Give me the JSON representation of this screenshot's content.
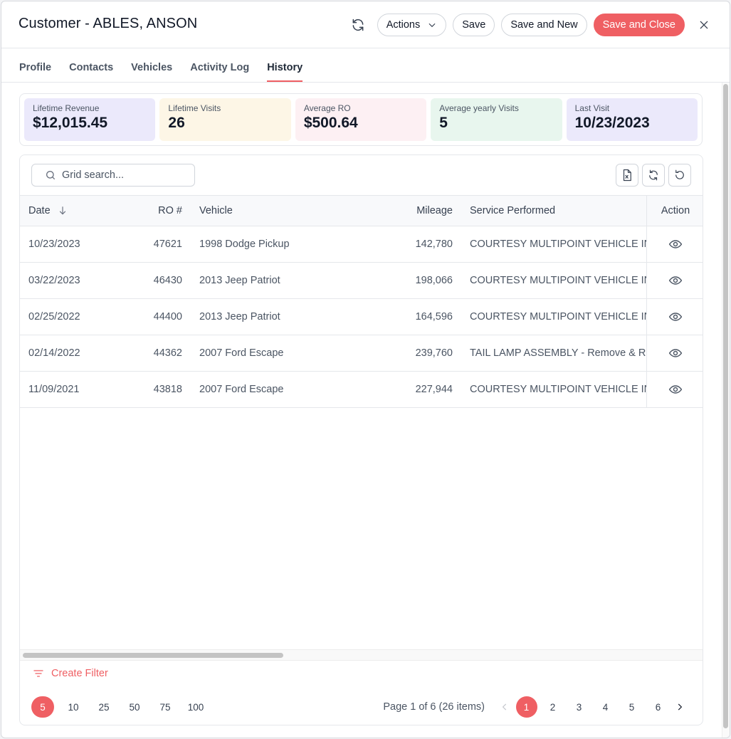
{
  "header": {
    "title": "Customer - ABLES, ANSON",
    "actions_label": "Actions",
    "save_label": "Save",
    "save_new_label": "Save and New",
    "save_close_label": "Save and Close"
  },
  "tabs": [
    {
      "label": "Profile"
    },
    {
      "label": "Contacts"
    },
    {
      "label": "Vehicles"
    },
    {
      "label": "Activity Log"
    },
    {
      "label": "History",
      "active": true
    }
  ],
  "stats": [
    {
      "label": "Lifetime Revenue",
      "value": "$12,015.45",
      "color": "#ebe9fb"
    },
    {
      "label": "Lifetime Visits",
      "value": "26",
      "color": "#fdf6e6"
    },
    {
      "label": "Average RO",
      "value": "$500.64",
      "color": "#fdf0f3"
    },
    {
      "label": "Average yearly Visits",
      "value": "5",
      "color": "#e8f6ee"
    },
    {
      "label": "Last Visit",
      "value": "10/23/2023",
      "color": "#ebe9fb"
    }
  ],
  "grid": {
    "search_placeholder": "Grid search...",
    "columns": {
      "date": "Date",
      "ro": "RO #",
      "vehicle": "Vehicle",
      "mileage": "Mileage",
      "service": "Service Performed",
      "action": "Action"
    },
    "rows": [
      {
        "date": "10/23/2023",
        "ro": "47621",
        "vehicle": "1998 Dodge Pickup",
        "mileage": "142,780",
        "service": "COURTESY MULTIPOINT VEHICLE IN"
      },
      {
        "date": "03/22/2023",
        "ro": "46430",
        "vehicle": "2013 Jeep Patriot",
        "mileage": "198,066",
        "service": "COURTESY MULTIPOINT VEHICLE IN"
      },
      {
        "date": "02/25/2022",
        "ro": "44400",
        "vehicle": "2013 Jeep Patriot",
        "mileage": "164,596",
        "service": "COURTESY MULTIPOINT VEHICLE IN"
      },
      {
        "date": "02/14/2022",
        "ro": "44362",
        "vehicle": "2007 Ford Escape",
        "mileage": "239,760",
        "service": "TAIL LAMP ASSEMBLY - Remove & Re"
      },
      {
        "date": "11/09/2021",
        "ro": "43818",
        "vehicle": "2007 Ford Escape",
        "mileage": "227,944",
        "service": "COURTESY MULTIPOINT VEHICLE IN"
      }
    ],
    "create_filter_label": "Create Filter",
    "page_sizes": [
      "5",
      "10",
      "25",
      "50",
      "75",
      "100"
    ],
    "page_size_selected": "5",
    "page_info": "Page 1 of 6 (26 items)",
    "pages": [
      "1",
      "2",
      "3",
      "4",
      "5",
      "6"
    ],
    "current_page": "1"
  },
  "colors": {
    "accent": "#ef5f63"
  }
}
